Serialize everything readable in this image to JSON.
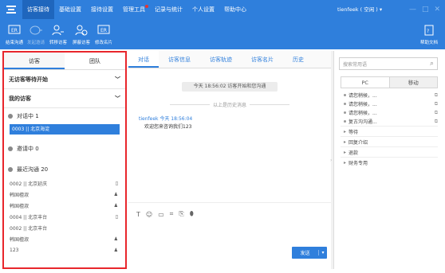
{
  "menu": {
    "items": [
      "访客接待",
      "基础设置",
      "接待设置",
      "管理工具",
      "记录与统计",
      "个人设置",
      "帮助中心"
    ]
  },
  "status": "tienfeek ( 空闲 ) ▾",
  "toolbar": {
    "end_chat": "结束沟通",
    "invite": "发起邀请",
    "transfer": "转移访客",
    "block": "屏蔽访客",
    "business_card": "修改名片",
    "help_doc": "帮助文档"
  },
  "left": {
    "tab_visitors": "访客",
    "tab_team": "团队",
    "no_waiting": "无访客等待开始",
    "my_visitors": "我的访客",
    "in_chat": "对话中  1",
    "selected_visitor": "0003 || 北京海淀",
    "inviting": "邀请中  0",
    "recent": "最近沟通  20",
    "rows": [
      "0002 || 北京延庆",
      "韩国檀淑",
      "韩国檀淑",
      "0004 || 北京丰台",
      "0002 || 北京丰台",
      "韩国檀淑",
      "123"
    ]
  },
  "chat": {
    "tabs": [
      "对话",
      "访客信息",
      "访客轨迹",
      "访客名片",
      "历史"
    ],
    "sysmsg": "今天 18:56:02 访客开始和您沟通",
    "history": "以上是历史消息",
    "agent_line": "tienfeek  今天 18:56:04",
    "message": "欢迎您来咨询我们123",
    "send": "发送"
  },
  "right": {
    "search_placeholder": "搜索常用语",
    "tab_pc": "PC",
    "tab_mobile": "移动",
    "items": [
      "请您稍候，...",
      "请您稍候，...",
      "请您稍候，...",
      "复古沟沟通..."
    ],
    "cats": [
      "等待",
      "回复介绍",
      "退款",
      "财务专用"
    ]
  }
}
